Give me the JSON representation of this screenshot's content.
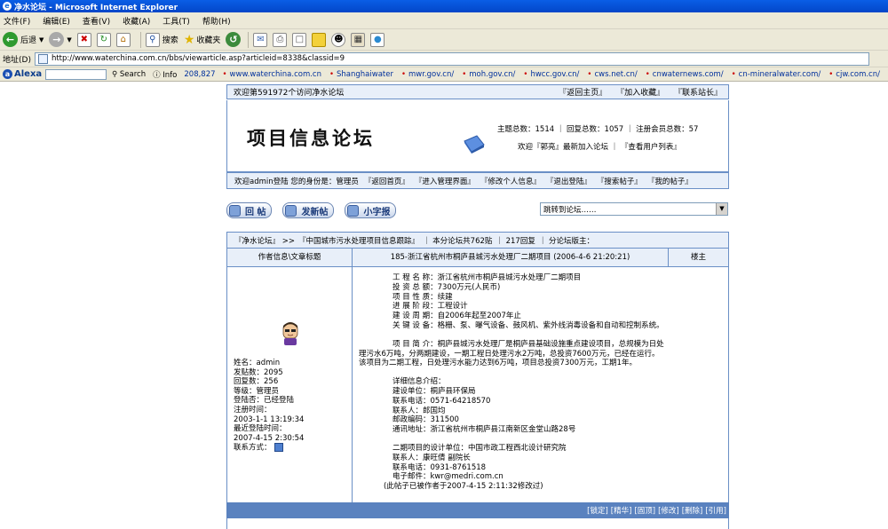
{
  "window": {
    "title": "净水论坛 - Microsoft Internet Explorer"
  },
  "menu": [
    "文件(F)",
    "编辑(E)",
    "查看(V)",
    "收藏(A)",
    "工具(T)",
    "帮助(H)"
  ],
  "toolbar": {
    "back": "后退",
    "search": "搜索",
    "favorites": "收藏夹"
  },
  "address": {
    "label": "地址(D)",
    "url": "http://www.waterchina.com.cn/bbs/viewarticle.asp?articleid=8338&classid=9"
  },
  "alexa": {
    "brand": "Alexa",
    "search": "Search",
    "info": "Info",
    "rank": "208,827",
    "links": [
      "www.waterchina.com.cn",
      "Shanghaiwater",
      "mwr.gov.cn/",
      "moh.gov.cn/",
      "hwcc.gov.cn/",
      "cws.net.cn/",
      "cnwaternews.com/",
      "cn-mineralwater.com/",
      "cjw.com.cn/"
    ]
  },
  "forum": {
    "visit_text": "欢迎第591972个访问净水论坛",
    "top_links": [
      "『返回主页』",
      "『加入收藏』",
      "『联系站长』"
    ],
    "logo": "项目信息论坛",
    "stats": "主题总数：1514 ｜ 回复总数：1057 ｜ 注册会员总数：57",
    "welcome_new": "欢迎『郭亮』最新加入论坛 ｜ 『查看用户列表』",
    "userbar": [
      "欢迎admin登陆 您的身份是：管理员",
      "『返回首页』",
      "『进入管理界面』",
      "『修改个人信息』",
      "『退出登陆』",
      "『搜索帖子』",
      "『我的帖子』"
    ],
    "buttons": {
      "reply": "回 帖",
      "new_post": "发新帖",
      "small": "小字报"
    },
    "jump": "跳转到论坛……",
    "crumb": [
      "『净水论坛』 >>",
      "『中国城市污水处理项目信息跟踪』",
      "｜ 本分论坛共762贴",
      "｜ 217回复",
      "｜ 分论坛版主："
    ],
    "table_head": {
      "author": "作者信息\\文章标题",
      "title": "185-浙江省杭州市桐庐县城污水处理厂二期项目 (2006-4-6 21:20:21)",
      "floor": "楼主"
    },
    "user": {
      "name": "姓名：admin",
      "posts": "发贴数：2095",
      "replies": "回复数：256",
      "level": "等级：管理员",
      "logged": "登陆否：已经登陆",
      "reg_label": "注册时间：",
      "reg_time": "2003-1-1 13:19:34",
      "last_label": "最近登陆时间：",
      "last_time": "2007-4-15 2:30:54",
      "contact": "联系方式："
    },
    "post": {
      "block1": [
        "工 程 名 称：浙江省杭州市桐庐县城污水处理厂二期项目",
        "投 资 总 额：7300万元(人民币)",
        "项 目 性 质：续建",
        "进 展 阶 段：工程设计",
        "建 设 周 期：自2006年起至2007年止",
        "关 键 设 备：格栅、泵、曝气设备、鼓风机、紫外线消毒设备和自动和控制系统。"
      ],
      "intro1": "项 目 简 介：桐庐县城污水处理厂是桐庐县基础设施重点建设项目，总规模为日处",
      "intro2": "理污水6万吨，分两期建设，一期工程日处理污水2万吨，总投资7600万元，已经在运行。",
      "intro3": "该项目为二期工程，日处理污水能力达到6万吨，项目总投资7300万元，工期1年。",
      "block2": [
        "详细信息介绍：",
        "建设单位：桐庐县环保局",
        "联系电话：0571-64218570",
        "联系人：郎国均",
        "邮政编码：311500",
        "通讯地址：浙江省杭州市桐庐县江南新区金堂山路28号"
      ],
      "block3": [
        "二期项目的设计单位：中国市政工程西北设计研究院",
        "联系人：康旺倩 副院长",
        "联系电话：0931-8761518",
        "电子邮件：kwr@medri.com.cn"
      ],
      "edited": "(此帖子已被作者于2007-4-15 2:11:32修改过)"
    },
    "actions": [
      "[锁定]",
      "[精华]",
      "[固顶]",
      "[修改]",
      "[删除]",
      "[引用]"
    ]
  }
}
